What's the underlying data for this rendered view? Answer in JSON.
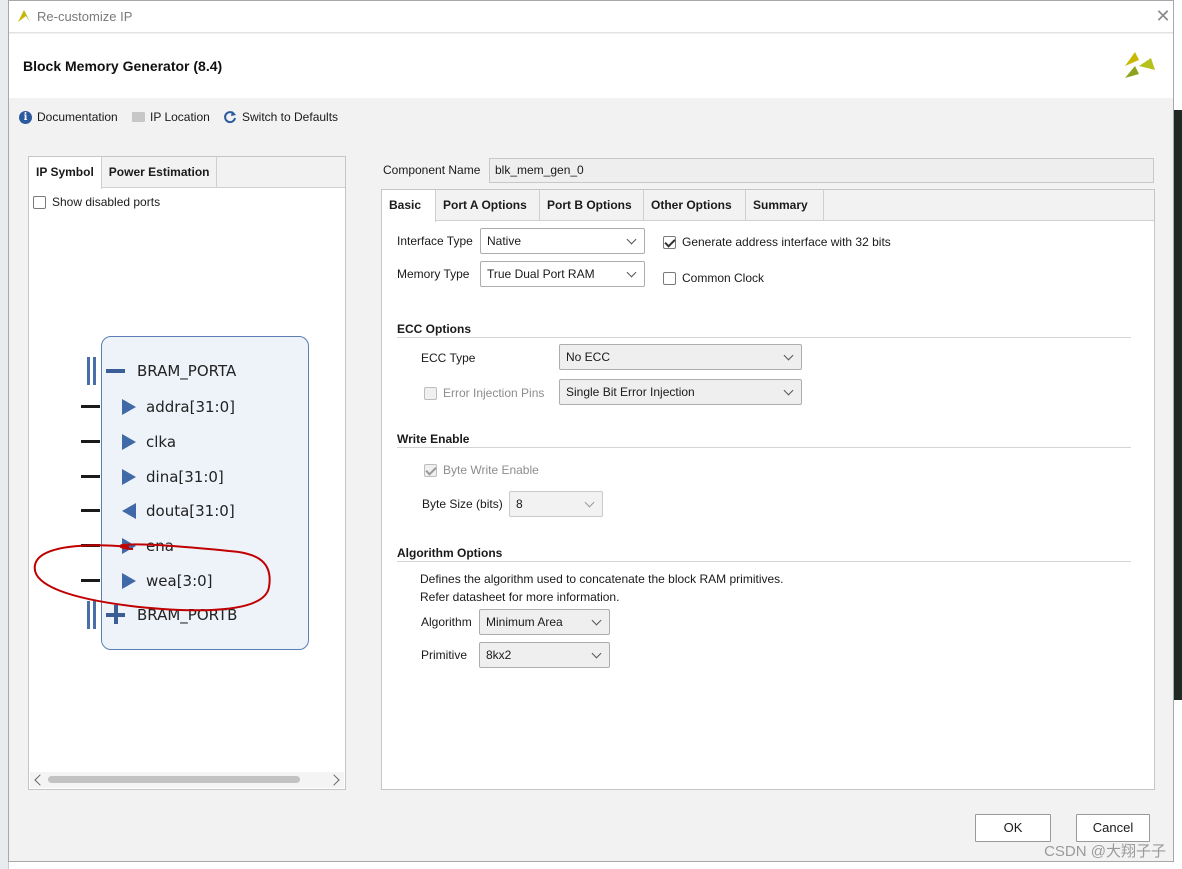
{
  "window": {
    "title": "Re-customize IP"
  },
  "header": {
    "title": "Block Memory Generator (8.4)"
  },
  "toolbar": {
    "documentation": "Documentation",
    "ip_location": "IP Location",
    "switch_defaults": "Switch to Defaults"
  },
  "left_panel": {
    "tabs": [
      "IP Symbol",
      "Power Estimation"
    ],
    "show_disabled_ports": "Show disabled ports",
    "symbol": {
      "port_a": "BRAM_PORTA",
      "port_b": "BRAM_PORTB",
      "pins": [
        {
          "label": "addra[31:0]",
          "dir": "in"
        },
        {
          "label": "clka",
          "dir": "in"
        },
        {
          "label": "dina[31:0]",
          "dir": "in"
        },
        {
          "label": "douta[31:0]",
          "dir": "out"
        },
        {
          "label": "ena",
          "dir": "in"
        },
        {
          "label": "wea[3:0]",
          "dir": "in"
        }
      ]
    }
  },
  "component": {
    "label": "Component Name",
    "value": "blk_mem_gen_0"
  },
  "tabs": [
    "Basic",
    "Port A Options",
    "Port B Options",
    "Other Options",
    "Summary"
  ],
  "basic": {
    "interface_type_label": "Interface Type",
    "interface_type_value": "Native",
    "memory_type_label": "Memory Type",
    "memory_type_value": "True Dual Port RAM",
    "gen_addr_label": "Generate address interface with 32 bits",
    "common_clock_label": "Common Clock",
    "ecc_section": "ECC Options",
    "ecc_type_label": "ECC Type",
    "ecc_type_value": "No ECC",
    "error_injection_label": "Error Injection Pins",
    "error_injection_value": "Single Bit Error Injection",
    "write_enable_section": "Write Enable",
    "byte_write_label": "Byte Write Enable",
    "byte_size_label": "Byte Size (bits)",
    "byte_size_value": "8",
    "algorithm_section": "Algorithm Options",
    "algo_desc_1": "Defines the algorithm used to concatenate the block RAM primitives.",
    "algo_desc_2": "Refer datasheet for more information.",
    "algorithm_label": "Algorithm",
    "algorithm_value": "Minimum Area",
    "primitive_label": "Primitive",
    "primitive_value": "8kx2"
  },
  "footer": {
    "ok": "OK",
    "cancel": "Cancel"
  },
  "watermark": "CSDN @大翔子子",
  "colors": {
    "symbol_fill": "#eef3fa",
    "symbol_border": "#5b7fb5",
    "pin_arrow": "#4069a8",
    "annotation": "#c00000"
  }
}
